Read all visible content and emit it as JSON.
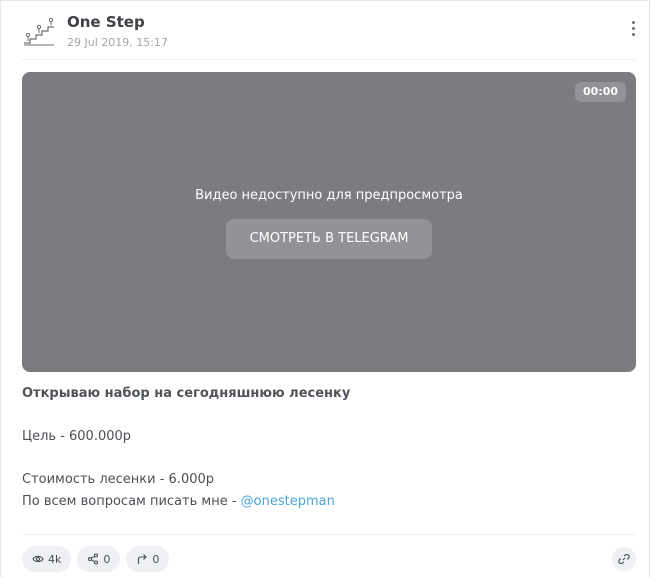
{
  "channel": {
    "name": "One Step",
    "date": "29 Jul 2019, 15:17",
    "avatar_icon": "stairs-people-icon"
  },
  "video": {
    "duration": "00:00",
    "unavailable_text": "Видео недоступно для предпросмотра",
    "button_label": "СМОТРЕТЬ В TELEGRAM"
  },
  "post": {
    "line1": "Открываю набор на сегодняшнюю лесенку",
    "line2": "Цель - 600.000р",
    "line3": "Стоимость лесенки - 6.000р",
    "line4_prefix": "По всем вопросам писать мне - ",
    "line4_link": "@onestepman"
  },
  "stats": {
    "views": "4k",
    "shares": "0",
    "forwards": "0"
  },
  "colors": {
    "video_bg": "#7b7c80",
    "link": "#4aa3d8",
    "pill_bg": "#eef0f3"
  }
}
